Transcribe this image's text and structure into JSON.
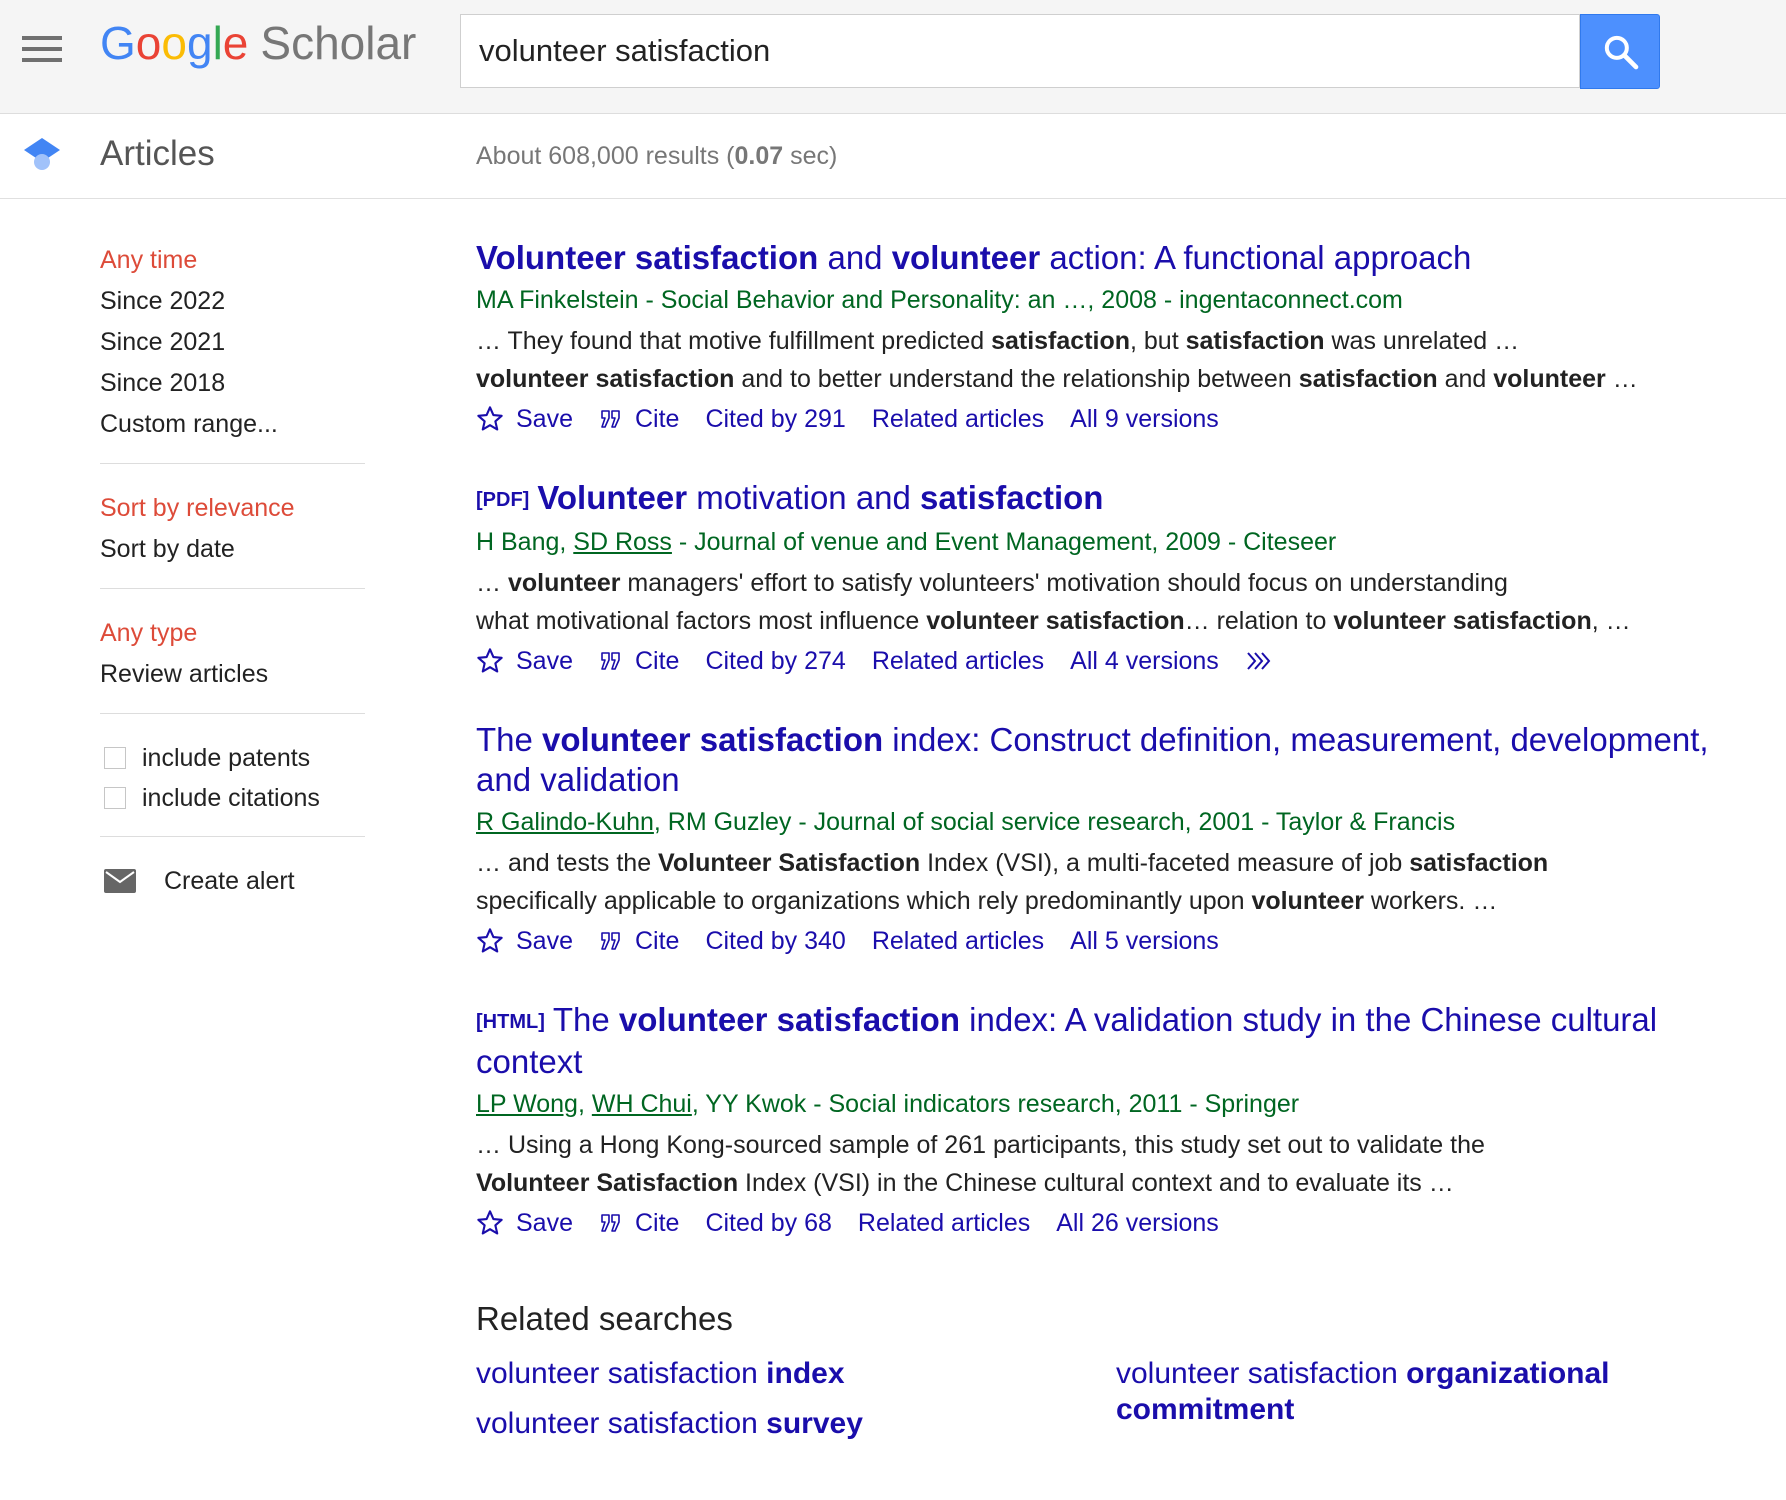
{
  "header": {
    "logo": {
      "letters": [
        "G",
        "o",
        "o",
        "g",
        "l",
        "e"
      ],
      "product": "Scholar"
    },
    "search": {
      "value": "volunteer satisfaction"
    },
    "icons": {
      "menu": "menu-icon",
      "search": "search-icon"
    }
  },
  "subheader": {
    "section_label": "Articles",
    "stats_prefix": "About 608,000 results (",
    "stats_time": "0.07",
    "stats_suffix": " sec)"
  },
  "sidebar": {
    "time_filters": [
      "Any time",
      "Since 2022",
      "Since 2021",
      "Since 2018",
      "Custom range..."
    ],
    "sort_options": [
      "Sort by relevance",
      "Sort by date"
    ],
    "type_filters": [
      "Any type",
      "Review articles"
    ],
    "checkboxes": [
      "include patents",
      "include citations"
    ],
    "create_alert": "Create alert"
  },
  "results": [
    {
      "tag": "",
      "title": [
        {
          "t": "Volunteer satisfaction",
          "b": true
        },
        {
          "t": " and ",
          "b": false
        },
        {
          "t": "volunteer",
          "b": true
        },
        {
          "t": " action: A functional approach",
          "b": false
        }
      ],
      "authors": [
        {
          "t": "MA Finkelstein - Social Behavior and Personality: an …, 2008 - ingentaconnect.com",
          "link": false
        }
      ],
      "snippet_lines": [
        [
          {
            "t": "… They found that motive fulfillment predicted ",
            "b": false
          },
          {
            "t": "satisfaction",
            "b": true
          },
          {
            "t": ", but ",
            "b": false
          },
          {
            "t": "satisfaction",
            "b": true
          },
          {
            "t": " was unrelated …",
            "b": false
          }
        ],
        [
          {
            "t": "volunteer satisfaction",
            "b": true
          },
          {
            "t": " and to better understand the relationship between ",
            "b": false
          },
          {
            "t": "satisfaction",
            "b": true
          },
          {
            "t": " and ",
            "b": false
          },
          {
            "t": "volunteer",
            "b": true
          },
          {
            "t": " …",
            "b": false
          }
        ]
      ],
      "actions": {
        "save": "Save",
        "cite": "Cite",
        "cited_by": "Cited by 291",
        "related": "Related articles",
        "versions": "All 9 versions"
      },
      "more": false
    },
    {
      "tag": "[PDF]",
      "title": [
        {
          "t": "Volunteer",
          "b": true
        },
        {
          "t": " motivation and ",
          "b": false
        },
        {
          "t": "satisfaction",
          "b": true
        }
      ],
      "authors": [
        {
          "t": "H Bang, ",
          "link": false
        },
        {
          "t": "SD Ross",
          "link": true
        },
        {
          "t": " - Journal of venue and Event Management, 2009 - Citeseer",
          "link": false
        }
      ],
      "snippet_lines": [
        [
          {
            "t": "… ",
            "b": false
          },
          {
            "t": "volunteer",
            "b": true
          },
          {
            "t": " managers' effort to satisfy volunteers' motivation should focus on understanding",
            "b": false
          }
        ],
        [
          {
            "t": "what motivational factors most influence ",
            "b": false
          },
          {
            "t": "volunteer satisfaction",
            "b": true
          },
          {
            "t": "… relation to ",
            "b": false
          },
          {
            "t": "volunteer satisfaction",
            "b": true
          },
          {
            "t": ", …",
            "b": false
          }
        ]
      ],
      "actions": {
        "save": "Save",
        "cite": "Cite",
        "cited_by": "Cited by 274",
        "related": "Related articles",
        "versions": "All 4 versions"
      },
      "more": true
    },
    {
      "tag": "",
      "title": [
        {
          "t": "The ",
          "b": false
        },
        {
          "t": "volunteer satisfaction",
          "b": true
        },
        {
          "t": " index: Construct definition, measurement, development, and validation",
          "b": false
        }
      ],
      "authors": [
        {
          "t": "R Galindo-Kuhn",
          "link": true
        },
        {
          "t": ", RM Guzley - Journal of social service research, 2001 - Taylor & Francis",
          "link": false
        }
      ],
      "snippet_lines": [
        [
          {
            "t": "… and tests the ",
            "b": false
          },
          {
            "t": "Volunteer Satisfaction",
            "b": true
          },
          {
            "t": " Index (VSI), a multi-faceted measure of job ",
            "b": false
          },
          {
            "t": "satisfaction",
            "b": true
          }
        ],
        [
          {
            "t": "specifically applicable to organizations which rely predominantly upon ",
            "b": false
          },
          {
            "t": "volunteer",
            "b": true
          },
          {
            "t": " workers. …",
            "b": false
          }
        ]
      ],
      "actions": {
        "save": "Save",
        "cite": "Cite",
        "cited_by": "Cited by 340",
        "related": "Related articles",
        "versions": "All 5 versions"
      },
      "more": false
    },
    {
      "tag": "[HTML]",
      "title": [
        {
          "t": "The ",
          "b": false
        },
        {
          "t": "volunteer satisfaction",
          "b": true
        },
        {
          "t": " index: A validation study in the Chinese cultural context",
          "b": false
        }
      ],
      "authors": [
        {
          "t": "LP Wong",
          "link": true
        },
        {
          "t": ", ",
          "link": false
        },
        {
          "t": "WH Chui",
          "link": true
        },
        {
          "t": ", YY Kwok - Social indicators research, 2011 - Springer",
          "link": false
        }
      ],
      "snippet_lines": [
        [
          {
            "t": "… Using a Hong Kong-sourced sample of 261 participants, this study set out to validate the",
            "b": false
          }
        ],
        [
          {
            "t": "Volunteer Satisfaction",
            "b": true
          },
          {
            "t": " Index (VSI) in the Chinese cultural context and to evaluate its …",
            "b": false
          }
        ]
      ],
      "actions": {
        "save": "Save",
        "cite": "Cite",
        "cited_by": "Cited by 68",
        "related": "Related articles",
        "versions": "All 26 versions"
      },
      "more": false
    }
  ],
  "related_searches": {
    "heading": "Related searches",
    "items": [
      [
        {
          "t": "volunteer satisfaction ",
          "b": false
        },
        {
          "t": "index",
          "b": true
        }
      ],
      [
        {
          "t": "volunteer satisfaction ",
          "b": false
        },
        {
          "t": "survey",
          "b": true
        }
      ],
      [
        {
          "t": "volunteer satisfaction ",
          "b": false
        },
        {
          "t": "organizational commitment",
          "b": true
        }
      ]
    ]
  },
  "colors": {
    "link": "#1a0dab",
    "author": "#006621",
    "active_filter": "#dd4b39",
    "search_button": "#4d90fe"
  }
}
